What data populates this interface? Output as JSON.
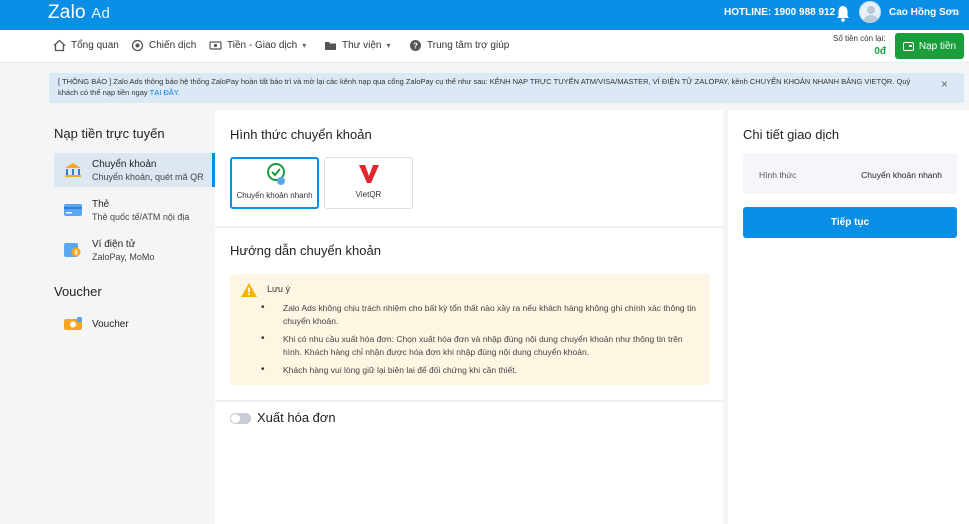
{
  "header": {
    "logo_main": "Zalo",
    "logo_sub": "Ad",
    "hotline": "HOTLINE: 1900 988 912",
    "user_name": "Cao Hồng Sơn",
    "brand_color": "#0a8ee6"
  },
  "nav": {
    "items": [
      {
        "label": "Tổng quan",
        "icon": "home-icon"
      },
      {
        "label": "Chiến dịch",
        "icon": "target-icon"
      },
      {
        "label": "Tiền - Giao dịch",
        "icon": "money-icon"
      },
      {
        "label": "Thư viện",
        "icon": "folder-icon"
      },
      {
        "label": "Trung tâm trợ giúp",
        "icon": "help-icon"
      }
    ],
    "balance_label": "Số tiền còn lại:",
    "balance_value": "0đ",
    "topup_label": "Nạp tiền"
  },
  "notice": {
    "text": "[ THÔNG BÁO ] Zalo Ads thông báo hệ thống ZaloPay hoàn tất bảo trì và mở lại các kênh nạp qua cổng ZaloPay cụ thể như sau: KÊNH NẠP TRỰC TUYẾN ATM/VISA/MASTER, VÍ ĐIỆN TỬ ZALOPAY, kênh CHUYỂN KHOẢN NHANH BẰNG VIETQR. Quý khách có thể nạp tiền ngay ",
    "link": "TẠI ĐÂY."
  },
  "sidebar": {
    "online_title": "Nạp tiền trực tuyến",
    "items": [
      {
        "title": "Chuyển khoản",
        "subtitle": "Chuyển khoản, quét mã QR",
        "icon": "bank-transfer-icon"
      },
      {
        "title": "Thẻ",
        "subtitle": "Thẻ quốc tế/ATM nội địa",
        "icon": "card-icon"
      },
      {
        "title": "Ví điện tử",
        "subtitle": "ZaloPay, MoMo",
        "icon": "wallet-icon"
      }
    ],
    "voucher_title": "Voucher",
    "voucher_item": "Voucher"
  },
  "main": {
    "method_title": "Hình thức chuyển khoản",
    "methods": [
      {
        "label": "Chuyển khoản nhanh",
        "selected": true
      },
      {
        "label": "VietQR",
        "selected": false
      }
    ],
    "guide_title": "Hướng dẫn chuyển khoản",
    "note_title": "Lưu ý",
    "notes": [
      "Zalo Ads không chịu trách nhiệm cho bất kỳ tổn thất nào xảy ra nếu khách hàng không ghi chính xác thông tin chuyển khoản.",
      "Khi có nhu cầu xuất hóa đơn: Chọn xuất hóa đơn và nhập đúng nội dung chuyển khoản như thông tin trên hình. Khách hàng chỉ nhận được hóa đơn khi nhập đúng nội dung chuyển khoản.",
      "Khách hàng vui lòng giữ lại biên lai để đối chứng khi cần thiết."
    ],
    "invoice_label": "Xuất hóa đơn",
    "invoice_enabled": false
  },
  "details": {
    "title": "Chi tiết giao dịch",
    "method_key": "Hình thức",
    "method_value": "Chuyển khoản nhanh",
    "continue_label": "Tiếp tục"
  }
}
